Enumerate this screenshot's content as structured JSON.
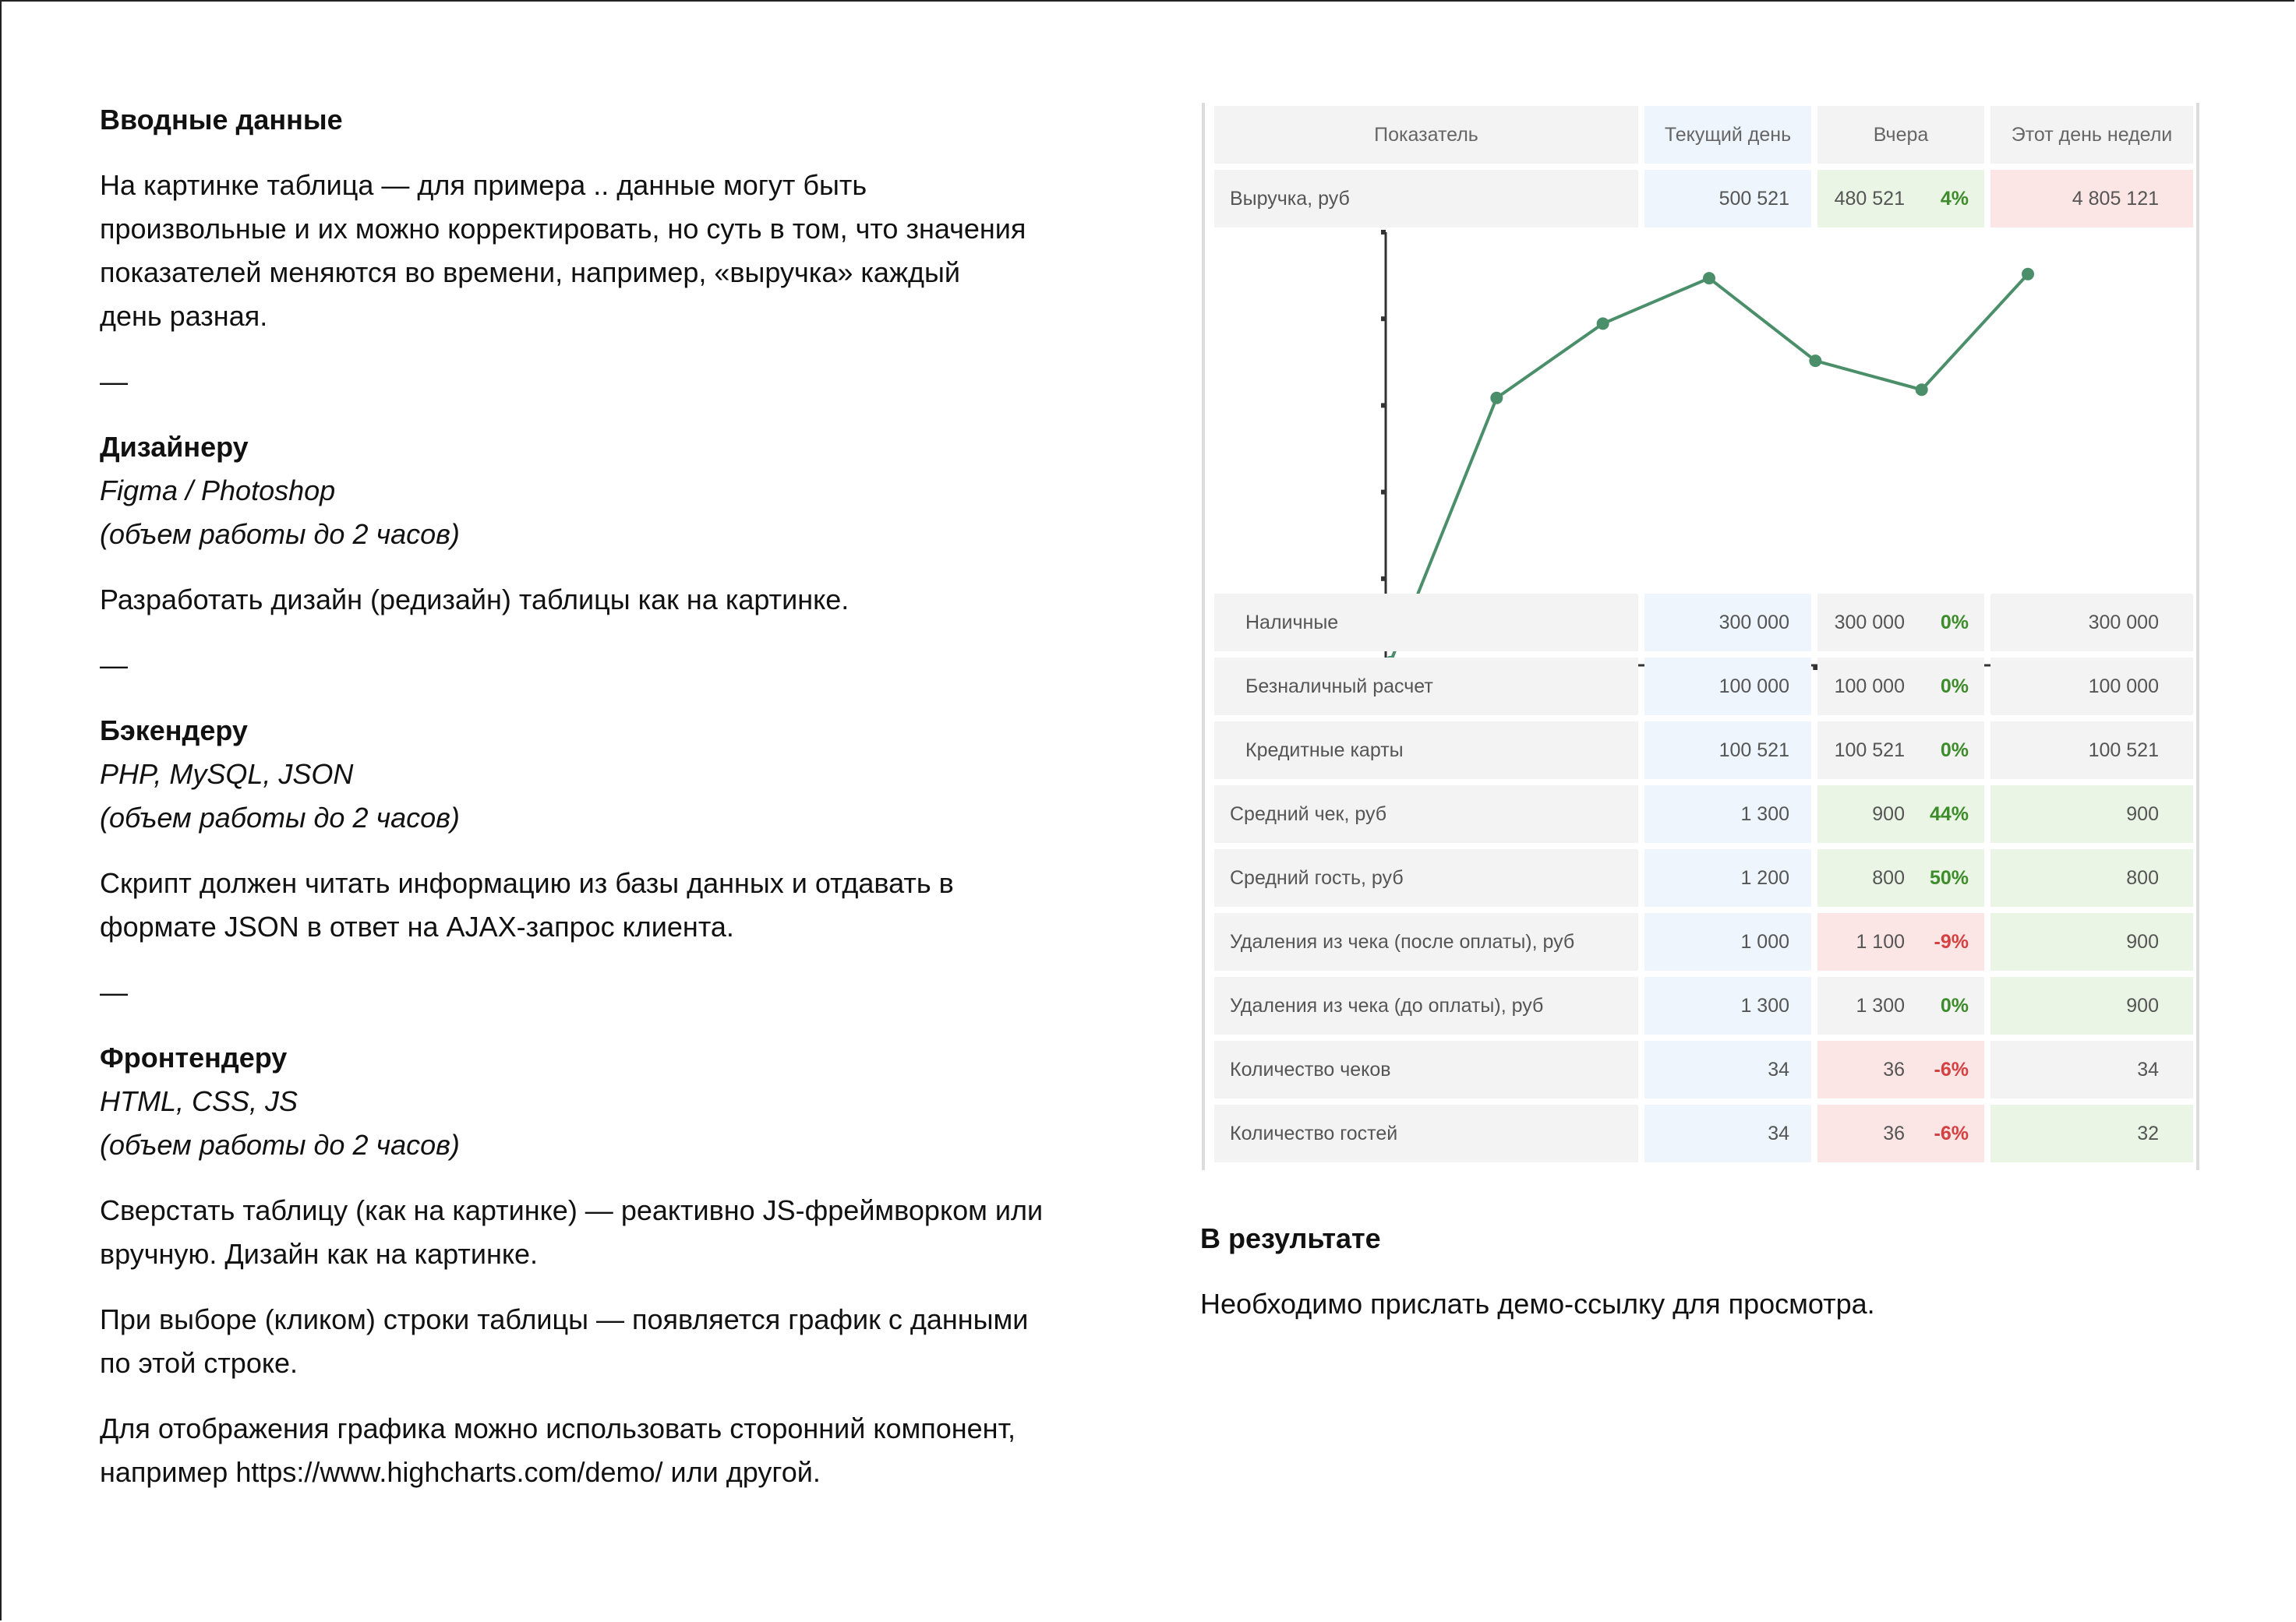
{
  "left": {
    "intro": {
      "title": "Вводные данные",
      "lines": [
        "На картинке таблица — для примера .. данные могут быть",
        "произвольные и их можно корректировать, но суть в том, что значения",
        "показателей меняются во времени, например, «выручка» каждый",
        "день разная."
      ]
    },
    "dash": "—",
    "designer": {
      "title": "Дизайнеру",
      "tools": "Figma / Photoshop",
      "scope": "(объем работы до 2 часов)",
      "task": "Разработать дизайн (редизайн) таблицы как на картинке."
    },
    "backend": {
      "title": "Бэкендеру",
      "tools": "PHP, MySQL, JSON",
      "scope": "(объем работы до 2 часов)",
      "lines": [
        "Скрипт должен читать информацию из базы данных и отдавать в",
        "формате JSON в ответ на AJAX-запрос клиента."
      ]
    },
    "frontend": {
      "title": "Фронтендеру",
      "tools": "HTML, CSS, JS",
      "scope": "(объем работы до 2 часов)",
      "p1": [
        "Сверстать таблицу (как на картинке) — реактивно JS-фреймворком или",
        "вручную. Дизайн как на картинке."
      ],
      "p2": [
        "При выборе (кликом) строки таблицы — появляется график с данными",
        "по этой строке."
      ],
      "p3": [
        "Для отображения графика можно использовать сторонний компонент,",
        "например https://www.highcharts.com/demo/ или другой."
      ]
    }
  },
  "table": {
    "headers": {
      "label": "Показатель",
      "current": "Текущий день",
      "yesterday": "Вчера",
      "week_day": "Этот день недели"
    },
    "revenue": {
      "label": "Выручка, руб",
      "current": "500 521",
      "yesterday": "480 521",
      "pct": "4%",
      "week_day": "4 805 121"
    },
    "rows": [
      {
        "label": "Наличные",
        "sub": true,
        "current": "300 000",
        "yesterday": "300 000",
        "pct": "0%",
        "week_day": "300 000",
        "yes_bg": "gray",
        "pct_sign": "pos",
        "week_bg": "gray"
      },
      {
        "label": "Безналичный расчет",
        "sub": true,
        "current": "100 000",
        "yesterday": "100 000",
        "pct": "0%",
        "week_day": "100 000",
        "yes_bg": "gray",
        "pct_sign": "pos",
        "week_bg": "gray"
      },
      {
        "label": "Кредитные карты",
        "sub": true,
        "current": "100 521",
        "yesterday": "100 521",
        "pct": "0%",
        "week_day": "100 521",
        "yes_bg": "gray",
        "pct_sign": "pos",
        "week_bg": "gray"
      },
      {
        "label": "Средний чек, руб",
        "sub": false,
        "current": "1 300",
        "yesterday": "900",
        "pct": "44%",
        "week_day": "900",
        "yes_bg": "green",
        "pct_sign": "pos",
        "week_bg": "green"
      },
      {
        "label": "Средний гость, руб",
        "sub": false,
        "current": "1 200",
        "yesterday": "800",
        "pct": "50%",
        "week_day": "800",
        "yes_bg": "green",
        "pct_sign": "pos",
        "week_bg": "green"
      },
      {
        "label": "Удаления из чека (после оплаты), руб",
        "sub": false,
        "current": "1 000",
        "yesterday": "1 100",
        "pct": "-9%",
        "week_day": "900",
        "yes_bg": "red",
        "pct_sign": "neg",
        "week_bg": "green"
      },
      {
        "label": "Удаления из чека (до оплаты), руб",
        "sub": false,
        "current": "1 300",
        "yesterday": "1 300",
        "pct": "0%",
        "week_day": "900",
        "yes_bg": "gray",
        "pct_sign": "pos",
        "week_bg": "green"
      },
      {
        "label": "Количество чеков",
        "sub": false,
        "current": "34",
        "yesterday": "36",
        "pct": "-6%",
        "week_day": "34",
        "yes_bg": "red",
        "pct_sign": "neg",
        "week_bg": "gray"
      },
      {
        "label": "Количество гостей",
        "sub": false,
        "current": "34",
        "yesterday": "36",
        "pct": "-6%",
        "week_day": "32",
        "yes_bg": "red",
        "pct_sign": "neg",
        "week_bg": "green"
      }
    ]
  },
  "colors": {
    "line": "#4a8f6a",
    "green_bg": "#eaf5e6",
    "red_bg": "#fbe5e5",
    "blue_bg": "#eef5fd",
    "gray_bg": "#f3f3f3",
    "positive": "#3d8c2a",
    "negative": "#d64040"
  },
  "chart_data": {
    "type": "line",
    "x": [
      1,
      2,
      3,
      4,
      5,
      6,
      7
    ],
    "values": [
      0,
      64,
      82,
      93,
      73,
      66,
      94
    ],
    "ylim": [
      0,
      100
    ],
    "grid": false
  },
  "result": {
    "title": "В результате",
    "text": "Необходимо прислать демо-ссылку для просмотра."
  }
}
